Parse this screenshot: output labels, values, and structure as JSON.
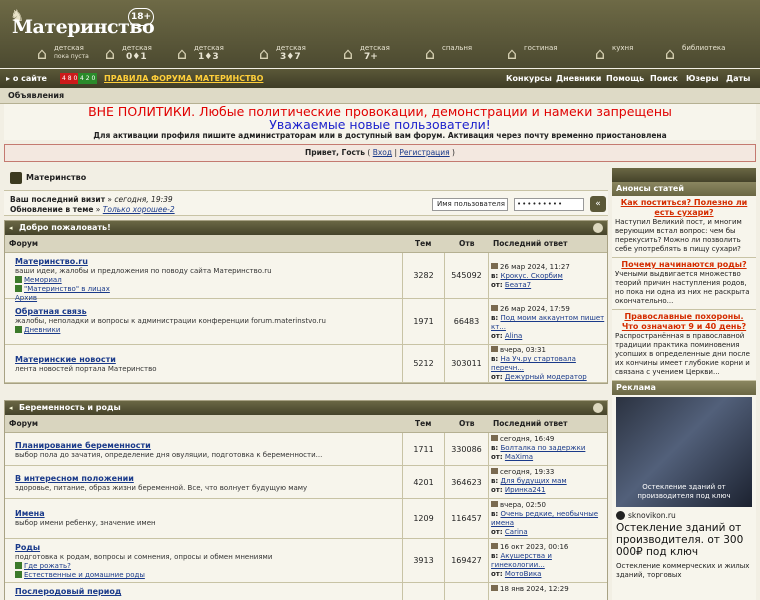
{
  "header": {
    "title": "Материнство",
    "age_badge": "18+",
    "rooms": [
      {
        "label": "детская",
        "age": "0",
        "sub": "пока пуста"
      },
      {
        "label": "детская",
        "age": "0♦1"
      },
      {
        "label": "детская",
        "age": "1♦3"
      },
      {
        "label": "детская",
        "age": "3♦7"
      },
      {
        "label": "детская",
        "age": "7+"
      },
      {
        "label": "спальня"
      },
      {
        "label": "гостиная"
      },
      {
        "label": "кухня"
      },
      {
        "label": "библиотека"
      }
    ]
  },
  "nav": {
    "about": "о сайте",
    "badge_red": "4 8 0",
    "badge_green": "4 2 0",
    "rules": "ПРАВИЛА ФОРУМА МАТЕРИНСТВО",
    "items": [
      "Конкурсы",
      "Дневники",
      "Помощь",
      "Поиск",
      "Юзеры",
      "Даты"
    ]
  },
  "announcement": {
    "bar": "Объявления",
    "line1": "ВНЕ ПОЛИТИКИ. Любые политические провокации, демонстрации и намеки запрещены",
    "line2": "Уважаемые новые пользователи!",
    "line3": "Для активации профиля пишите администраторам или в доступный вам форум. Активация через почту временно приостановлена"
  },
  "greeting": {
    "text": "Привет, Гость",
    "login": "Вход",
    "register": "Регистрация"
  },
  "breadcrumb": "Материнство",
  "visit": {
    "last_label": "Ваш последний визит",
    "last_value": "сегодня, 19:39",
    "update_label": "Обновление в теме",
    "update_value": "Только хорошее-2",
    "username_placeholder": "Имя пользователя",
    "password_value": "•••••••••",
    "go": "«"
  },
  "columns": {
    "forum": "Форум",
    "topics": "Тем",
    "replies": "Отв",
    "last": "Последний ответ"
  },
  "categories": [
    {
      "title": "Добро пожаловать!",
      "forums": [
        {
          "name": "Материнство.ru",
          "desc": "ваши идеи, жалобы и предложения по поводу сайта Материнство.ru",
          "subs": [
            "Мемориал",
            "\"Материнство\" в лицах",
            "Архив"
          ],
          "topics": "3282",
          "replies": "545092",
          "last_date": "26 мар 2024, 11:27",
          "last_topic": "Крокус. Скорбим",
          "last_user": "Беата7"
        },
        {
          "name": "Обратная связь",
          "desc": "жалобы, неполадки и вопросы к администрации конференции forum.materinstvo.ru",
          "subs": [
            "Дневники"
          ],
          "topics": "1971",
          "replies": "66483",
          "last_date": "26 мар 2024, 17:59",
          "last_topic": "Под моим аккаунтом пишет кт...",
          "last_user": "Alina"
        },
        {
          "name": "Материнские новости",
          "desc": "лента новостей портала Материнство",
          "subs": [],
          "topics": "5212",
          "replies": "303011",
          "last_date": "вчера, 03:31",
          "last_topic": "На Уч.ру стартовала перечн...",
          "last_user": "Дежурный модератор"
        }
      ]
    },
    {
      "title": "Беременность и роды",
      "forums": [
        {
          "name": "Планирование беременности",
          "desc": "выбор пола до зачатия, определение дня овуляции, подготовка к беременности...",
          "subs": [],
          "topics": "1711",
          "replies": "330086",
          "last_date": "сегодня, 16:49",
          "last_topic": "Болталка по задержки",
          "last_user": "MaXima"
        },
        {
          "name": "В интересном положении",
          "desc": "здоровье, питание, образ жизни беременной. Все, что волнует будущую маму",
          "subs": [],
          "topics": "4201",
          "replies": "364623",
          "last_date": "сегодня, 19:33",
          "last_topic": "Для будущих мам",
          "last_user": "Иринка241"
        },
        {
          "name": "Имена",
          "desc": "выбор имени ребенку, значение имен",
          "subs": [],
          "topics": "1209",
          "replies": "116457",
          "last_date": "вчера, 02:50",
          "last_topic": "Очень редкие, необычные имена",
          "last_user": "Carina"
        },
        {
          "name": "Роды",
          "desc": "подготовка к родам, вопросы и сомнения, опросы и обмен мнениями",
          "subs": [
            "Где рожать?",
            "Естественные и домашние роды"
          ],
          "topics": "3913",
          "replies": "169427",
          "last_date": "16 окт 2023, 00:16",
          "last_topic": "Акушерства и гинекологии...",
          "last_user": "МотоВика"
        },
        {
          "name": "Послеродовый период",
          "desc": "",
          "subs": [],
          "topics": "",
          "replies": "",
          "last_date": "18 янв 2024, 12:29",
          "last_topic": "",
          "last_user": ""
        }
      ]
    }
  ],
  "sidebar": {
    "articles_title": "Анонсы статей",
    "articles": [
      {
        "title": "Как поститься? Полезно ли есть сухари?",
        "desc": "Наступил Великий пост, и многим верующим встал вопрос: чем бы перекусить? Можно ли позволить себе употреблять в пищу сухари?"
      },
      {
        "title": "Почему начинаются роды?",
        "desc": "Учеными выдвигается множество теорий причин наступления родов, но пока ни одна из них не раскрыта окончательно..."
      },
      {
        "title": "Православные похороны. Что означают 9 и 40 день?",
        "desc": "Распространённая в православной традиции практика поминовения усопших в определенные дни после их кончины имеет глубокие корни и связана с учением Церкви..."
      }
    ],
    "ad_title": "Реклама",
    "ad_image_text": "Остекление зданий от производителя под ключ",
    "ad_domain": "sknovikon.ru",
    "ad_headline": "Остекление зданий от производителя. от 300 000₽ под ключ",
    "ad_text": "Остекление коммерческих и жилых зданий, торговых"
  },
  "colors": {
    "accent_red": "#e00000",
    "accent_blue": "#1d22cc",
    "header_olive": "#5b5838",
    "article_orange": "#d42c00"
  }
}
